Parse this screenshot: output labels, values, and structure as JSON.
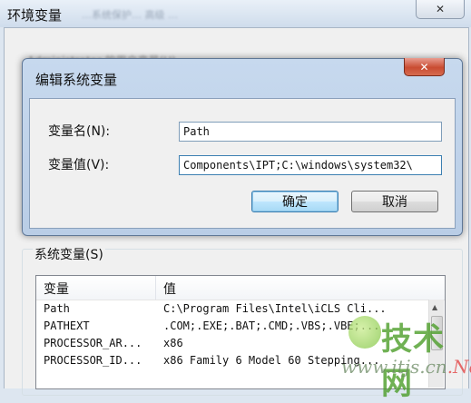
{
  "outer": {
    "title": "环境变量",
    "close_glyph": "✕",
    "blurred_title_text": "…系统保护… 高级 …",
    "user_vars_blurred": "Administrator 的用户变量(U)"
  },
  "edit_dialog": {
    "title": "编辑系统变量",
    "close_glyph": "✕",
    "name_label": "变量名(N):",
    "value_label": "变量值(V):",
    "name_value": "Path",
    "value_value": "Components\\IPT;C:\\windows\\system32\\",
    "ok_label": "确定",
    "cancel_label": "取消"
  },
  "system_vars": {
    "group_label": "系统变量(S)",
    "columns": [
      "变量",
      "值"
    ],
    "rows": [
      {
        "name": "Path",
        "value": "C:\\Program Files\\Intel\\iCLS Cli..."
      },
      {
        "name": "PATHEXT",
        "value": ".COM;.EXE;.BAT;.CMD;.VBS;.VBE;..."
      },
      {
        "name": "PROCESSOR_AR...",
        "value": "x86"
      },
      {
        "name": "PROCESSOR_ID...",
        "value": "x86 Family 6 Model 60 Stepping..."
      }
    ]
  },
  "watermark": {
    "text": "技术网",
    "url_prefix": "www.itjs.cn",
    "url_suffix": ".Net"
  }
}
